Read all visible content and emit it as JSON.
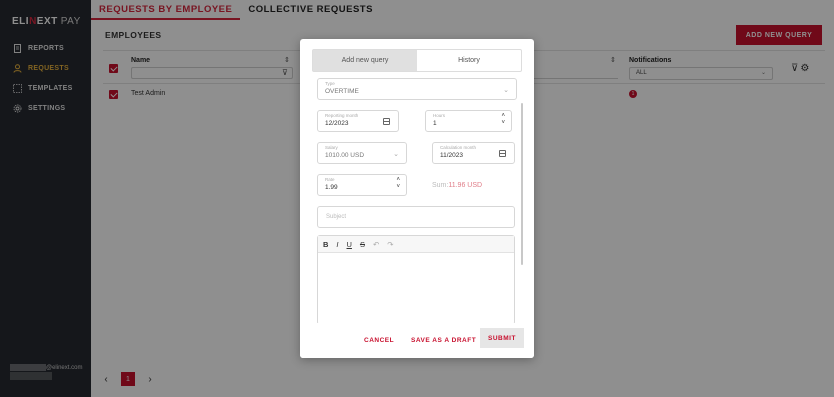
{
  "app": {
    "logo_eli": "ELI",
    "logo_n": "N",
    "logo_ext": "EXT",
    "logo_pay": "PAY"
  },
  "sidebar": {
    "items": [
      {
        "label": "REPORTS",
        "icon": "document-icon"
      },
      {
        "label": "REQUESTS",
        "icon": "person-icon",
        "active": true
      },
      {
        "label": "TEMPLATES",
        "icon": "template-icon"
      },
      {
        "label": "SETTINGS",
        "icon": "gear-icon"
      }
    ],
    "user_email_suffix": "@elinext.com"
  },
  "tabs": [
    {
      "label": "REQUESTS BY EMPLOYEE",
      "active": true
    },
    {
      "label": "COLLECTIVE REQUESTS",
      "active": false
    }
  ],
  "main": {
    "section_title": "EMPLOYEES",
    "add_button": "ADD NEW QUERY"
  },
  "table": {
    "col_name": "Name",
    "col_notifications": "Notifications",
    "notifications_filter": "ALL",
    "rows": [
      {
        "name": "Test Admin",
        "notifications": "1"
      }
    ]
  },
  "pager": {
    "prev": "‹",
    "page": "1",
    "next": "›"
  },
  "modal": {
    "tab_new": "Add new query",
    "tab_history": "History",
    "type_label": "Type",
    "type_value": "OVERTIME",
    "accounting_label": "Reporting month",
    "accounting_value": "12/2023",
    "hours_label": "Hours",
    "hours_value": "1",
    "salary_label": "Salary",
    "salary_value": "1010.00 USD",
    "calc_label": "Calculation month",
    "calc_value": "11/2023",
    "rate_label": "Rate",
    "rate_value": "1.99",
    "sum_label": "Sum:",
    "sum_value": "11.96 USD",
    "subject_placeholder": "Subject",
    "toolbar": {
      "bold": "B",
      "italic": "I",
      "underline": "U",
      "strike": "S",
      "undo": "↶",
      "redo": "↷"
    },
    "cancel": "CANCEL",
    "draft": "SAVE AS A DRAFT",
    "submit": "SUBMIT"
  },
  "colors": {
    "accent": "#c8102e",
    "sidebar_bg": "#262a31",
    "active_nav": "#e8b23d"
  }
}
